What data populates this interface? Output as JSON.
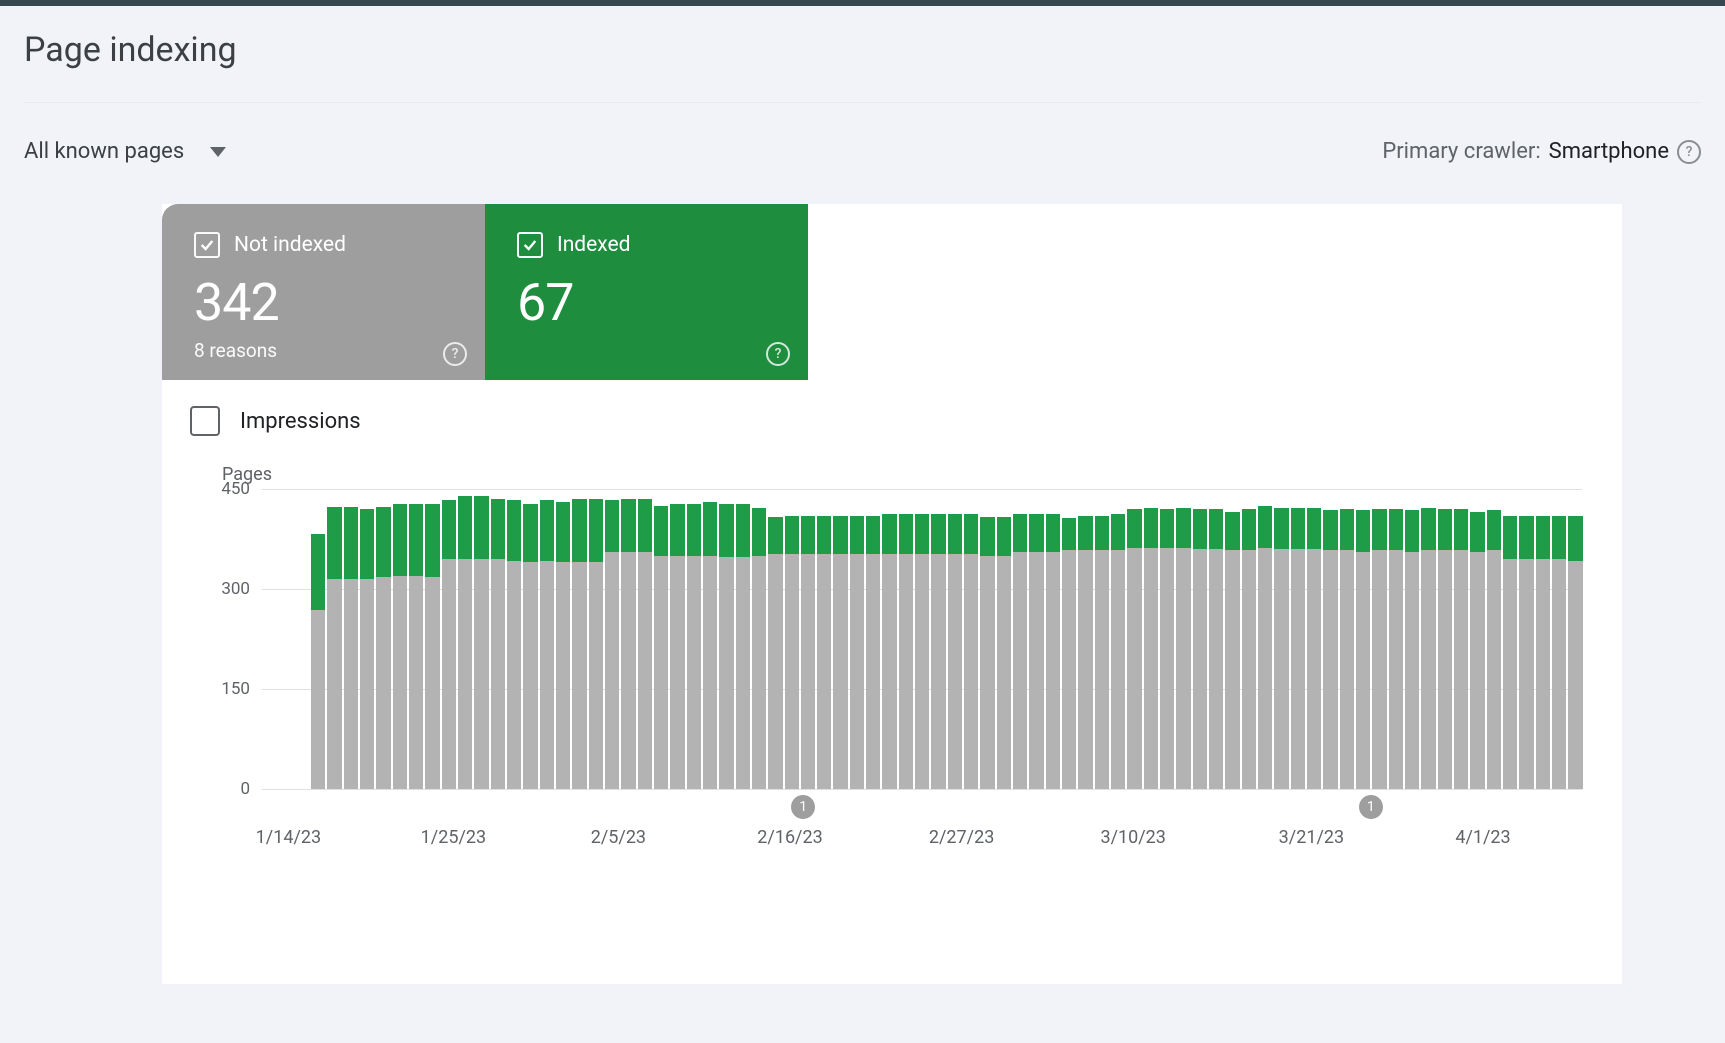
{
  "title": "Page indexing",
  "filter": {
    "label": "All known pages"
  },
  "crawler": {
    "prefix": "Primary crawler: ",
    "value": "Smartphone"
  },
  "tiles": {
    "not_indexed": {
      "label": "Not indexed",
      "count": "342",
      "sub": "8 reasons",
      "checked": true
    },
    "indexed": {
      "label": "Indexed",
      "count": "67",
      "checked": true
    }
  },
  "impressions": {
    "label": "Impressions",
    "checked": false
  },
  "chart_data": {
    "type": "bar",
    "stacked": true,
    "ylabel": "Pages",
    "ylim": [
      0,
      450
    ],
    "yticks": [
      0,
      150,
      300,
      450
    ],
    "xticks": [
      "1/14/23",
      "1/25/23",
      "2/5/23",
      "2/16/23",
      "2/27/23",
      "3/10/23",
      "3/21/23",
      "4/1/23"
    ],
    "xtick_positions_pct": [
      2,
      14.5,
      27,
      40,
      53,
      66,
      79.5,
      92.5
    ],
    "markers": [
      {
        "label": "1",
        "position_pct": 41
      },
      {
        "label": "1",
        "position_pct": 84
      }
    ],
    "series": [
      {
        "name": "Not indexed",
        "color": "#b3b3b3"
      },
      {
        "name": "Indexed",
        "color": "#1f9c47"
      }
    ],
    "data": [
      {
        "not_indexed": 0,
        "indexed": 0
      },
      {
        "not_indexed": 0,
        "indexed": 0
      },
      {
        "not_indexed": 0,
        "indexed": 0
      },
      {
        "not_indexed": 268,
        "indexed": 115
      },
      {
        "not_indexed": 315,
        "indexed": 108
      },
      {
        "not_indexed": 315,
        "indexed": 108
      },
      {
        "not_indexed": 315,
        "indexed": 105
      },
      {
        "not_indexed": 318,
        "indexed": 105
      },
      {
        "not_indexed": 320,
        "indexed": 107
      },
      {
        "not_indexed": 320,
        "indexed": 107
      },
      {
        "not_indexed": 318,
        "indexed": 110
      },
      {
        "not_indexed": 345,
        "indexed": 88
      },
      {
        "not_indexed": 345,
        "indexed": 95
      },
      {
        "not_indexed": 345,
        "indexed": 95
      },
      {
        "not_indexed": 345,
        "indexed": 90
      },
      {
        "not_indexed": 342,
        "indexed": 92
      },
      {
        "not_indexed": 340,
        "indexed": 88
      },
      {
        "not_indexed": 342,
        "indexed": 92
      },
      {
        "not_indexed": 340,
        "indexed": 90
      },
      {
        "not_indexed": 340,
        "indexed": 95
      },
      {
        "not_indexed": 340,
        "indexed": 95
      },
      {
        "not_indexed": 355,
        "indexed": 78
      },
      {
        "not_indexed": 355,
        "indexed": 80
      },
      {
        "not_indexed": 355,
        "indexed": 80
      },
      {
        "not_indexed": 350,
        "indexed": 75
      },
      {
        "not_indexed": 350,
        "indexed": 78
      },
      {
        "not_indexed": 350,
        "indexed": 78
      },
      {
        "not_indexed": 350,
        "indexed": 80
      },
      {
        "not_indexed": 348,
        "indexed": 80
      },
      {
        "not_indexed": 348,
        "indexed": 80
      },
      {
        "not_indexed": 350,
        "indexed": 72
      },
      {
        "not_indexed": 352,
        "indexed": 56
      },
      {
        "not_indexed": 352,
        "indexed": 58
      },
      {
        "not_indexed": 352,
        "indexed": 58
      },
      {
        "not_indexed": 352,
        "indexed": 58
      },
      {
        "not_indexed": 352,
        "indexed": 58
      },
      {
        "not_indexed": 352,
        "indexed": 58
      },
      {
        "not_indexed": 352,
        "indexed": 58
      },
      {
        "not_indexed": 352,
        "indexed": 60
      },
      {
        "not_indexed": 352,
        "indexed": 60
      },
      {
        "not_indexed": 352,
        "indexed": 60
      },
      {
        "not_indexed": 352,
        "indexed": 60
      },
      {
        "not_indexed": 352,
        "indexed": 60
      },
      {
        "not_indexed": 352,
        "indexed": 60
      },
      {
        "not_indexed": 350,
        "indexed": 58
      },
      {
        "not_indexed": 350,
        "indexed": 58
      },
      {
        "not_indexed": 355,
        "indexed": 58
      },
      {
        "not_indexed": 355,
        "indexed": 58
      },
      {
        "not_indexed": 355,
        "indexed": 58
      },
      {
        "not_indexed": 358,
        "indexed": 48
      },
      {
        "not_indexed": 358,
        "indexed": 52
      },
      {
        "not_indexed": 358,
        "indexed": 52
      },
      {
        "not_indexed": 358,
        "indexed": 55
      },
      {
        "not_indexed": 362,
        "indexed": 58
      },
      {
        "not_indexed": 362,
        "indexed": 60
      },
      {
        "not_indexed": 362,
        "indexed": 58
      },
      {
        "not_indexed": 362,
        "indexed": 60
      },
      {
        "not_indexed": 360,
        "indexed": 60
      },
      {
        "not_indexed": 360,
        "indexed": 60
      },
      {
        "not_indexed": 358,
        "indexed": 58
      },
      {
        "not_indexed": 358,
        "indexed": 62
      },
      {
        "not_indexed": 362,
        "indexed": 62
      },
      {
        "not_indexed": 360,
        "indexed": 62
      },
      {
        "not_indexed": 360,
        "indexed": 62
      },
      {
        "not_indexed": 360,
        "indexed": 62
      },
      {
        "not_indexed": 358,
        "indexed": 60
      },
      {
        "not_indexed": 358,
        "indexed": 62
      },
      {
        "not_indexed": 356,
        "indexed": 62
      },
      {
        "not_indexed": 358,
        "indexed": 62
      },
      {
        "not_indexed": 358,
        "indexed": 62
      },
      {
        "not_indexed": 356,
        "indexed": 62
      },
      {
        "not_indexed": 358,
        "indexed": 64
      },
      {
        "not_indexed": 358,
        "indexed": 62
      },
      {
        "not_indexed": 358,
        "indexed": 62
      },
      {
        "not_indexed": 356,
        "indexed": 60
      },
      {
        "not_indexed": 358,
        "indexed": 60
      },
      {
        "not_indexed": 345,
        "indexed": 65
      },
      {
        "not_indexed": 345,
        "indexed": 65
      },
      {
        "not_indexed": 345,
        "indexed": 65
      },
      {
        "not_indexed": 345,
        "indexed": 65
      },
      {
        "not_indexed": 342,
        "indexed": 67
      }
    ]
  }
}
